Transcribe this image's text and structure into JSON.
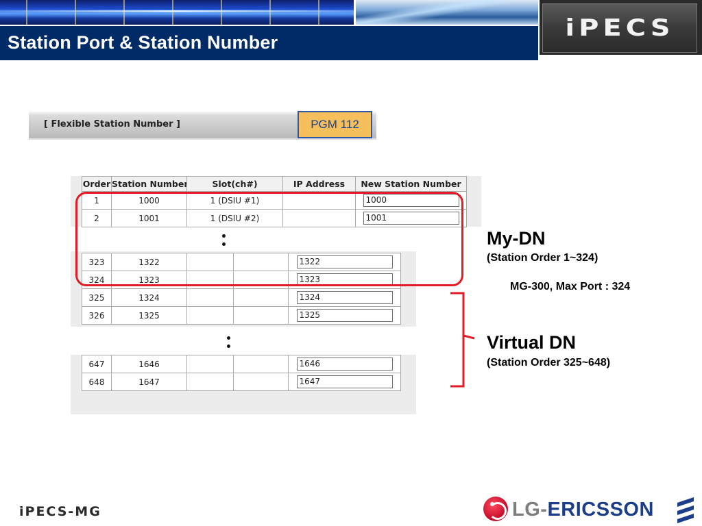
{
  "header": {
    "title": "Station Port & Station Number",
    "brand_logo": "iPECS"
  },
  "pgm": {
    "section_label": "[ Flexible Station Number ]",
    "badge": "PGM 112"
  },
  "table": {
    "columns": [
      "Order",
      "Station Number",
      "Slot(ch#)",
      "IP Address",
      "New Station Number"
    ],
    "group1": [
      {
        "order": "1",
        "station": "1000",
        "slot": "1 (DSIU #1)",
        "ip": "",
        "new": "1000"
      },
      {
        "order": "2",
        "station": "1001",
        "slot": "1 (DSIU #2)",
        "ip": "",
        "new": "1001"
      }
    ],
    "group2": [
      {
        "order": "323",
        "station": "1322",
        "slot": "",
        "ip": "",
        "new": "1322"
      },
      {
        "order": "324",
        "station": "1323",
        "slot": "",
        "ip": "",
        "new": "1323"
      },
      {
        "order": "325",
        "station": "1324",
        "slot": "",
        "ip": "",
        "new": "1324"
      },
      {
        "order": "326",
        "station": "1325",
        "slot": "",
        "ip": "",
        "new": "1325"
      }
    ],
    "group3": [
      {
        "order": "647",
        "station": "1646",
        "slot": "",
        "ip": "",
        "new": "1646"
      },
      {
        "order": "648",
        "station": "1647",
        "slot": "",
        "ip": "",
        "new": "1647"
      }
    ]
  },
  "annotations": {
    "my_dn_title": "My-DN",
    "my_dn_sub": "(Station Order 1~324)",
    "max_port": "MG-300, Max Port : 324",
    "virtual_dn_title": "Virtual DN",
    "virtual_dn_sub": "(Station Order 325~648)",
    "highlight_color": "#e31b23"
  },
  "footer": {
    "product_logo": "iPECS-MG",
    "company_lg": "LG",
    "company_dash": "-",
    "company_ericsson": "ERICSSON"
  },
  "colors": {
    "title_bar": "#002b66",
    "pgm_badge_bg": "#f5c05b",
    "pgm_badge_border": "#2f58a8"
  }
}
